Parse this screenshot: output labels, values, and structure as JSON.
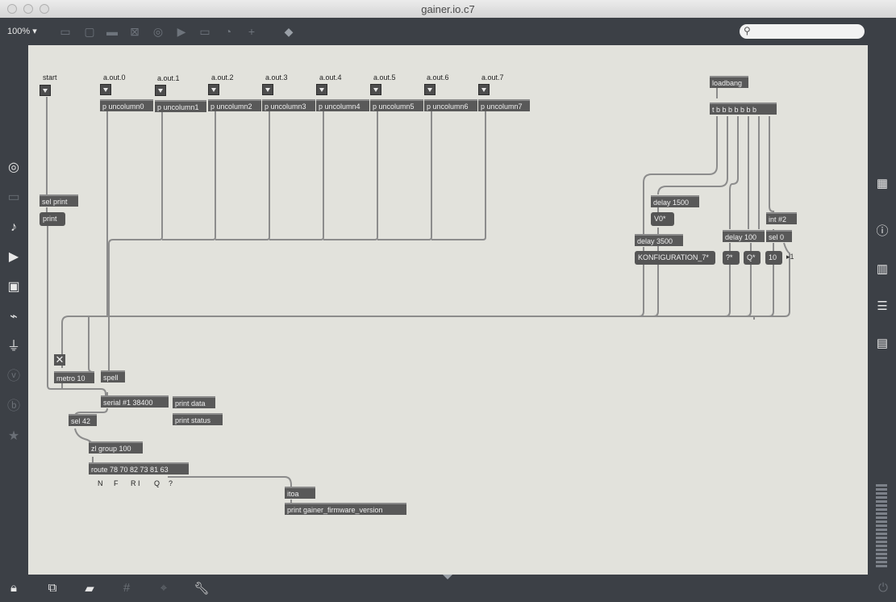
{
  "window": {
    "title": "gainer.io.c7"
  },
  "toolbar": {
    "zoom": "100%",
    "zoom_caret": "▾"
  },
  "patch": {
    "comments": {
      "start": "start",
      "aout0": "a.out.0",
      "aout1": "a.out.1",
      "aout2": "a.out.2",
      "aout3": "a.out.3",
      "aout4": "a.out.4",
      "aout5": "a.out.5",
      "aout6": "a.out.6",
      "aout7": "a.out.7",
      "N": "N",
      "F": "F",
      "RI": "R I",
      "Q": "Q",
      "q": "?"
    },
    "objects": {
      "uncol0": "p uncolumn0",
      "uncol1": "p uncolumn1",
      "uncol2": "p uncolumn2",
      "uncol3": "p uncolumn3",
      "uncol4": "p uncolumn4",
      "uncol5": "p uncolumn5",
      "uncol6": "p uncolumn6",
      "uncol7": "p uncolumn7",
      "loadbang": "loadbang",
      "trigger": "t b b b b b b b",
      "selprint": "sel print",
      "delay1500": "delay 1500",
      "delay3500": "delay 3500",
      "delay100": "delay 100",
      "int2": "int #2",
      "sel0": "sel 0",
      "metro": "metro 10",
      "spell": "spell",
      "serial": "serial #1 38400",
      "printdata": "print data",
      "printstatus": "print status",
      "sel42": "sel 42",
      "zlgroup": "zl group 100",
      "route": "route 78 70 82 73 81 63",
      "itoa": "itoa",
      "printfw": "print gainer_firmware_version"
    },
    "messages": {
      "print": "print",
      "v0": "V0*",
      "konfig": "KONFIGURATION_7*",
      "q": "?*",
      "Q": "Q*",
      "ten": "10"
    },
    "numbox": "▸1",
    "toggle": "✕"
  },
  "icons": {
    "zoom-caret": "chevron-down-icon",
    "search": "search-icon",
    "lock": "lock-icon",
    "wrench": "wrench-icon"
  }
}
